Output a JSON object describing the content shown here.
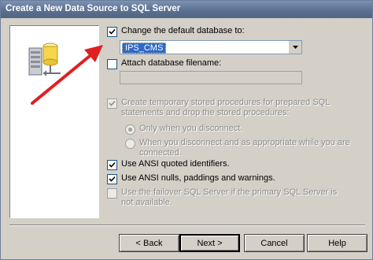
{
  "window": {
    "title": "Create a New Data Source to SQL Server"
  },
  "options": {
    "change_default_db": {
      "label": "Change the default database to:",
      "checked": true
    },
    "database_value": "IPS_CMS",
    "attach_db": {
      "label": "Attach database filename:",
      "checked": false
    },
    "temp_procs": {
      "label": "Create temporary stored procedures for prepared SQL statements and drop the stored procedures:",
      "checked": true,
      "enabled": false
    },
    "radio_disconnect": {
      "label": "Only when you disconnect.",
      "selected": true,
      "enabled": false
    },
    "radio_appropriate": {
      "label": "When you disconnect and as appropriate while you are connected.",
      "selected": false,
      "enabled": false
    },
    "ansi_quoted": {
      "label": "Use ANSI quoted identifiers.",
      "checked": true
    },
    "ansi_nulls": {
      "label": "Use ANSI nulls, paddings and warnings.",
      "checked": true
    },
    "failover": {
      "label": "Use the failover SQL Server if the primary SQL Server is not available.",
      "checked": false,
      "enabled": false
    }
  },
  "buttons": {
    "back": "< Back",
    "next": "Next >",
    "cancel": "Cancel",
    "help": "Help"
  },
  "colors": {
    "annotation_arrow": "#e02020",
    "selection": "#3169c6"
  }
}
